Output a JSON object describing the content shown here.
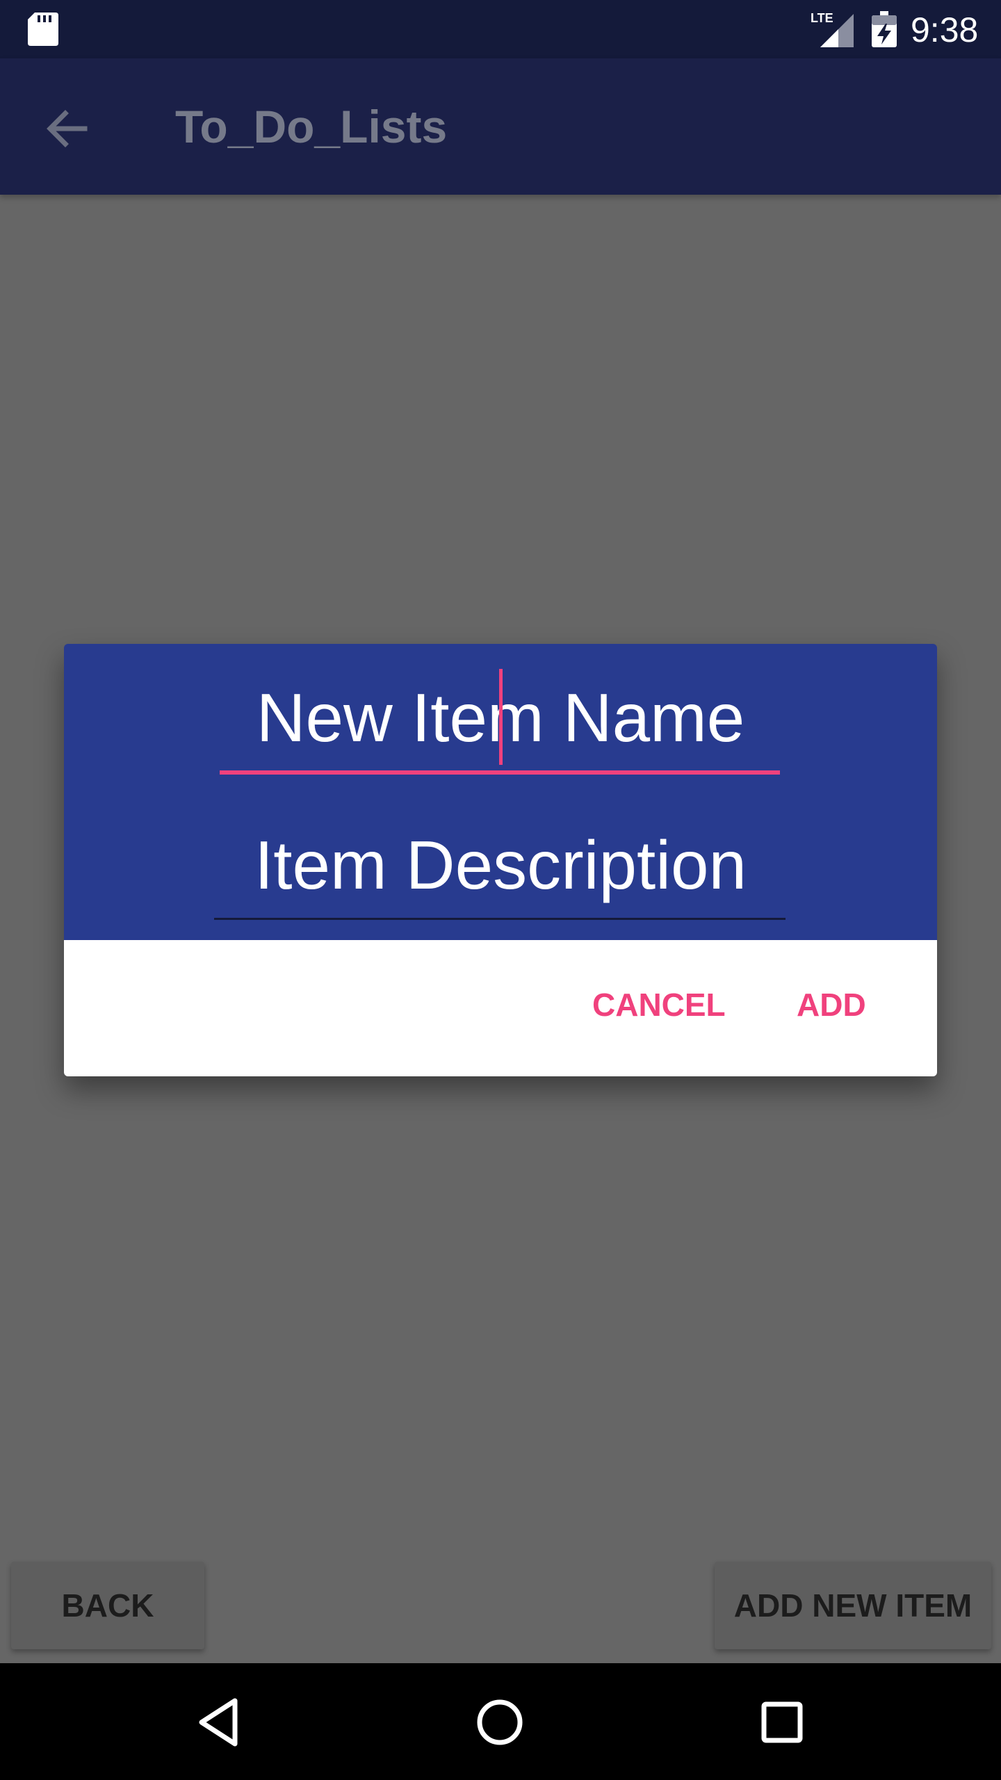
{
  "status_bar": {
    "time": "9:38",
    "network_label": "LTE",
    "icons": [
      "sd-card-icon",
      "lte-signal-icon",
      "battery-charging-icon"
    ]
  },
  "app_bar": {
    "title": "To_Do_Lists",
    "back_icon": "arrow-left-icon"
  },
  "dialog": {
    "name_placeholder": "New Item Name",
    "description_placeholder": "Item Description",
    "cancel_label": "CANCEL",
    "add_label": "ADD"
  },
  "bottom_buttons": {
    "back_label": "BACK",
    "add_new_item_label": "ADD NEW ITEM"
  },
  "nav_bar": {
    "icons": [
      "nav-back-icon",
      "nav-home-icon",
      "nav-recent-icon"
    ]
  },
  "colors": {
    "status_bar": "#141a3a",
    "app_bar": "#1b2048",
    "dialog_header": "#283b8f",
    "accent": "#f0417d",
    "scrim_background": "#666666"
  }
}
